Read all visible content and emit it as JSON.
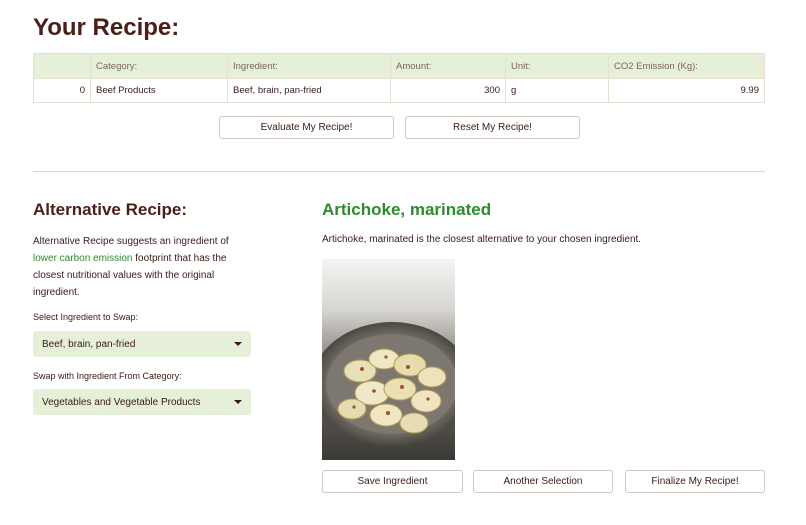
{
  "header": {
    "title": "Your Recipe:"
  },
  "table": {
    "columns": [
      "",
      "Category:",
      "Ingredient:",
      "Amount:",
      "Unit:",
      "CO2 Emission (Kg):"
    ],
    "rows": [
      {
        "index": "0",
        "category": "Beef Products",
        "ingredient": "Beef, brain, pan-fried",
        "amount": "300",
        "unit": "g",
        "co2": "9.99"
      }
    ]
  },
  "actions": {
    "evaluate_label": "Evaluate My Recipe!",
    "reset_label": "Reset My Recipe!"
  },
  "alternative": {
    "title": "Alternative Recipe:",
    "desc_part1": "Alternative Recipe suggests an ingredient of ",
    "desc_highlight": "lower carbon emission",
    "desc_part2": " footprint that has the closest nutritional values with the original ingredient.",
    "swap_label": "Select Ingredient to Swap:",
    "swap_value": "Beef, brain, pan-fried",
    "category_label": "Swap with Ingredient From Category:",
    "category_value": "Vegetables and Vegetable Products"
  },
  "result": {
    "title": "Artichoke, marinated",
    "description": "Artichoke, marinated is the closest alternative to your chosen ingredient.",
    "save_label": "Save Ingredient",
    "another_label": "Another Selection",
    "finalize_label": "Finalize My Recipe!"
  },
  "colors": {
    "accent_green": "#2e8b2e",
    "header_bg": "#e6f0d8",
    "text_brown": "#4a1f1a"
  }
}
